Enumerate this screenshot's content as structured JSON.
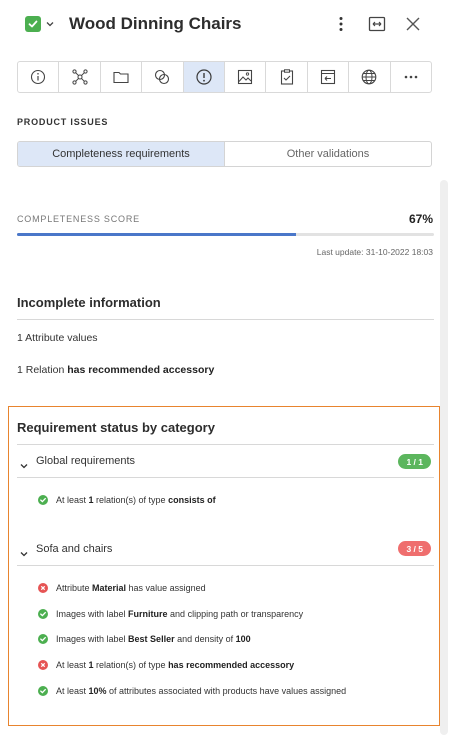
{
  "header": {
    "title": "Wood Dinning Chairs",
    "status_icon": "check-icon",
    "status_color": "#4caf50"
  },
  "toolbar": {
    "buttons": [
      {
        "icon": "info-icon"
      },
      {
        "icon": "network-icon"
      },
      {
        "icon": "folder-icon"
      },
      {
        "icon": "overlap-circles-icon"
      },
      {
        "icon": "alert-circle-icon",
        "active": true
      },
      {
        "icon": "image-icon"
      },
      {
        "icon": "clipboard-check-icon"
      },
      {
        "icon": "import-icon"
      },
      {
        "icon": "globe-icon"
      },
      {
        "icon": "more-icon"
      }
    ]
  },
  "product_issues": {
    "label": "PRODUCT ISSUES",
    "tabs": [
      "Completeness requirements",
      "Other validations"
    ],
    "active_tab": 0
  },
  "completeness": {
    "label": "COMPLETENESS SCORE",
    "score": "67%",
    "progress": 0.67,
    "last_update": "Last update: 31-10-2022 18:03",
    "accent": "#4a77c9"
  },
  "incomplete": {
    "title": "Incomplete information",
    "items": [
      {
        "prefix": "1 Attribute values",
        "bold": ""
      },
      {
        "prefix": "1 Relation ",
        "bold": "has recommended accessory"
      }
    ]
  },
  "requirements": {
    "title": "Requirement status by category",
    "highlight_color": "#e8842e",
    "categories": [
      {
        "name": "Global requirements",
        "badge": "1 / 1",
        "badge_status": "green",
        "items": [
          {
            "status": "ok",
            "parts": [
              [
                "At least ",
                false
              ],
              [
                "1",
                true
              ],
              [
                " relation(s) of type ",
                false
              ],
              [
                "consists of",
                true
              ]
            ]
          }
        ]
      },
      {
        "name": "Sofa and chairs",
        "badge": "3 / 5",
        "badge_status": "red",
        "items": [
          {
            "status": "fail",
            "parts": [
              [
                "Attribute ",
                false
              ],
              [
                "Material",
                true
              ],
              [
                " has value assigned",
                false
              ]
            ]
          },
          {
            "status": "ok",
            "parts": [
              [
                "Images with label ",
                false
              ],
              [
                "Furniture",
                true
              ],
              [
                " and clipping path or transparency",
                false
              ]
            ]
          },
          {
            "status": "ok",
            "parts": [
              [
                "Images with label ",
                false
              ],
              [
                "Best Seller",
                true
              ],
              [
                " and density of ",
                false
              ],
              [
                "100",
                true
              ]
            ]
          },
          {
            "status": "fail",
            "parts": [
              [
                "At least ",
                false
              ],
              [
                "1",
                true
              ],
              [
                " relation(s) of type ",
                false
              ],
              [
                "has recommended accessory",
                true
              ]
            ]
          },
          {
            "status": "ok",
            "parts": [
              [
                "At least ",
                false
              ],
              [
                "10%",
                true
              ],
              [
                " of attributes associated with products have values assigned",
                false
              ]
            ]
          }
        ]
      }
    ]
  }
}
